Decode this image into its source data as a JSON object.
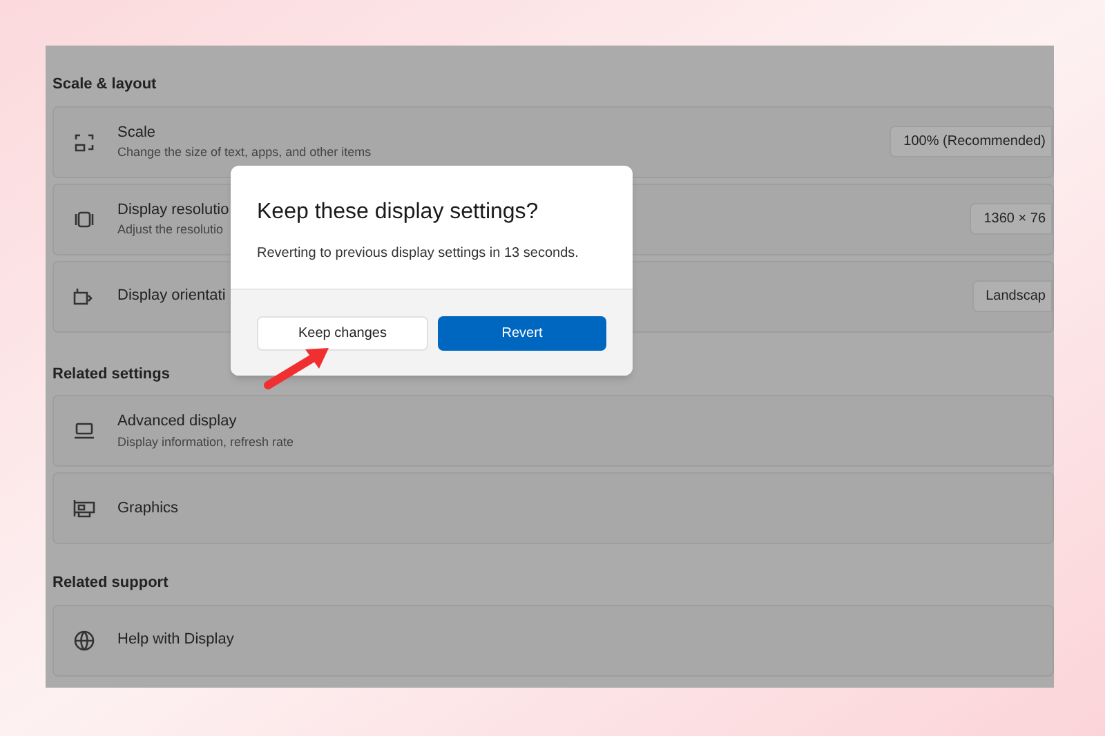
{
  "sections": [
    {
      "title": "Scale & layout",
      "rows": [
        {
          "title": "Scale",
          "subtitle": "Change the size of text, apps, and other items",
          "value": "100% (Recommended)"
        },
        {
          "title": "Display resolutio",
          "subtitle": "Adjust the resolutio",
          "value": "1360 × 76"
        },
        {
          "title": "Display orientati",
          "value": "Landscap"
        }
      ]
    },
    {
      "title": "Related settings",
      "rows": [
        {
          "title": "Advanced display",
          "subtitle": "Display information, refresh rate"
        },
        {
          "title": "Graphics"
        }
      ]
    },
    {
      "title": "Related support",
      "rows": [
        {
          "title": "Help with Display"
        }
      ]
    }
  ],
  "dialog": {
    "title": "Keep these display settings?",
    "message": "Reverting to previous display settings in 13 seconds.",
    "buttons": [
      {
        "label": "Keep changes",
        "kind": "secondary"
      },
      {
        "label": "Revert",
        "kind": "primary"
      }
    ]
  }
}
